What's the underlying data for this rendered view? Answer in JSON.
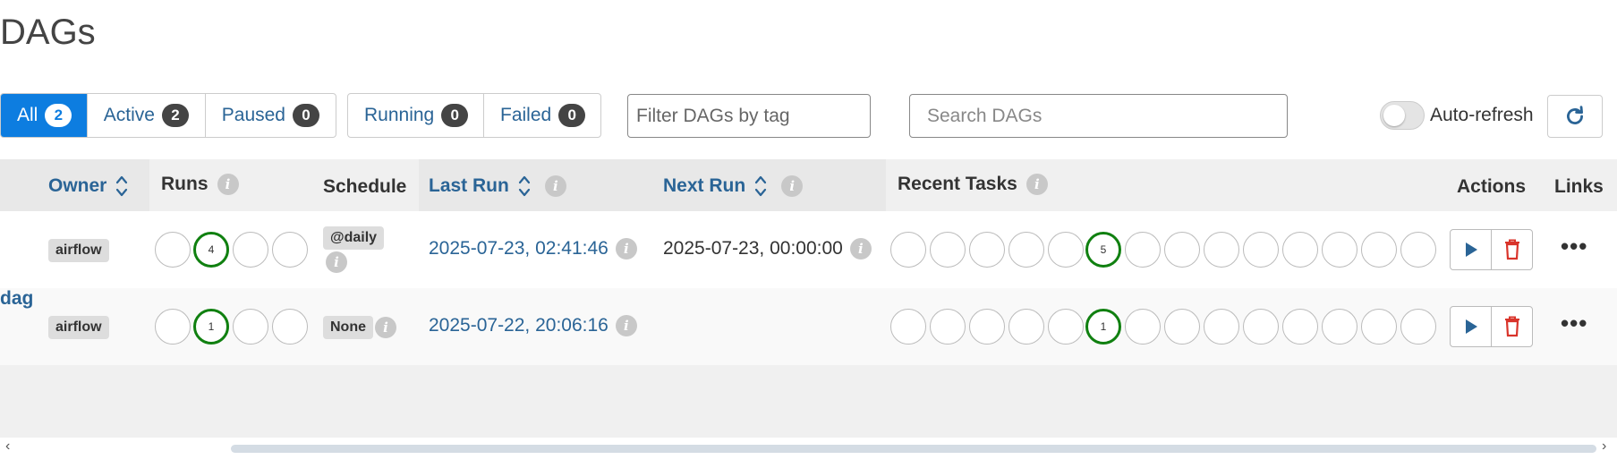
{
  "page": {
    "title": "DAGs"
  },
  "filters": {
    "status": [
      {
        "label": "All",
        "count": "2",
        "active": true
      },
      {
        "label": "Active",
        "count": "2"
      },
      {
        "label": "Paused",
        "count": "0"
      }
    ],
    "run_state": [
      {
        "label": "Running",
        "count": "0"
      },
      {
        "label": "Failed",
        "count": "0"
      }
    ],
    "tag_filter_placeholder": "Filter DAGs by tag",
    "search_placeholder": "Search DAGs",
    "auto_refresh_label": "Auto-refresh"
  },
  "table": {
    "headers": {
      "owner": "Owner",
      "runs": "Runs",
      "schedule": "Schedule",
      "last_run": "Last Run",
      "next_run": "Next Run",
      "recent_tasks": "Recent Tasks",
      "actions": "Actions",
      "links": "Links"
    },
    "rows": [
      {
        "dag_id_fragment": "",
        "owner": "airflow",
        "runs_success_count": "4",
        "schedule": "@daily",
        "last_run": "2025-07-23, 02:41:46",
        "next_run": "2025-07-23, 00:00:00",
        "recent_tasks_success_count": "5"
      },
      {
        "dag_id_fragment": "dag",
        "owner": "airflow",
        "runs_success_count": "1",
        "schedule": "None",
        "last_run": "2025-07-22, 20:06:16",
        "next_run": "",
        "recent_tasks_success_count": "1"
      }
    ]
  },
  "colors": {
    "primary": "#0d7de0",
    "link": "#2a6496",
    "success": "#108010",
    "danger": "#d9342b"
  },
  "icons": {
    "refresh": "refresh-icon",
    "trigger": "play-icon",
    "delete": "trash-icon",
    "more": "ellipsis-icon",
    "sort": "sort-icon",
    "info": "info-icon"
  }
}
